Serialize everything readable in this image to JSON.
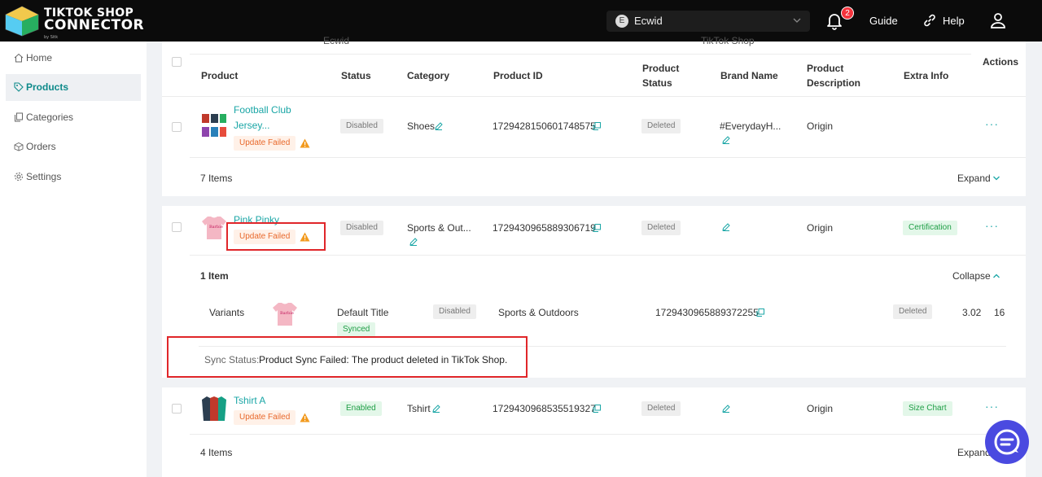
{
  "header": {
    "logo_line1": "TIKTOK SHOP",
    "logo_line2": "CONNECTOR",
    "logo_byline": "by Sitk",
    "store_initial": "E",
    "store_name": "Ecwid",
    "notification_count": "2",
    "guide_label": "Guide",
    "help_label": "Help"
  },
  "sidebar": {
    "items": [
      {
        "label": "Home",
        "icon": "home-icon"
      },
      {
        "label": "Products",
        "icon": "tag-icon"
      },
      {
        "label": "Categories",
        "icon": "copy-icon"
      },
      {
        "label": "Orders",
        "icon": "box-icon"
      },
      {
        "label": "Settings",
        "icon": "gear-icon"
      }
    ]
  },
  "table": {
    "group_ecwid": "Ecwid",
    "group_tiktok": "TikTok Shop",
    "columns": {
      "product": "Product",
      "status": "Status",
      "category": "Category",
      "product_id": "Product ID",
      "product_status_1": "Product",
      "product_status_2": "Status",
      "brand_name": "Brand Name",
      "product_desc_1": "Product",
      "product_desc_2": "Description",
      "extra_info": "Extra Info",
      "actions": "Actions"
    },
    "rows": [
      {
        "name_line1": "Football Club",
        "name_line2": "Jersey...",
        "sync_tag": "Update Failed",
        "status": "Disabled",
        "category": "Shoes",
        "product_id": "1729428150601748575",
        "tiktok_status": "Deleted",
        "brand_line1": "#EverydayH...",
        "description": "Origin",
        "items_label": "7 Items",
        "toggle_label": "Expand"
      },
      {
        "name_line1": "Pink Pinky",
        "sync_tag": "Update Failed",
        "status": "Disabled",
        "category": "Sports & Out...",
        "product_id": "1729430965889306719",
        "tiktok_status": "Deleted",
        "description": "Origin",
        "extra_info": "Certification",
        "items_label": "1 Item",
        "toggle_label": "Collapse",
        "variant": {
          "label": "Variants",
          "title": "Default Title",
          "sync": "Synced",
          "status": "Disabled",
          "category": "Sports & Outdoors",
          "product_id": "1729430965889372255",
          "tiktok_status": "Deleted",
          "price": "3.02",
          "qty": "16"
        },
        "sync_status_label": "Sync Status:",
        "sync_status_text": "Product Sync Failed: The product deleted in TikTok Shop."
      },
      {
        "name_line1": "Tshirt A",
        "sync_tag": "Update Failed",
        "status": "Enabled",
        "category": "Tshirt",
        "product_id": "1729430968535519327",
        "tiktok_status": "Deleted",
        "description": "Origin",
        "extra_info": "Size Chart",
        "items_label": "4 Items",
        "toggle_label": "Expand"
      }
    ]
  },
  "actions_glyph": "···",
  "colors": {
    "accent": "#1aa6a6",
    "header_bg": "#0b0b0b",
    "fail": "#e8692c",
    "highlight": "#e0262a"
  }
}
